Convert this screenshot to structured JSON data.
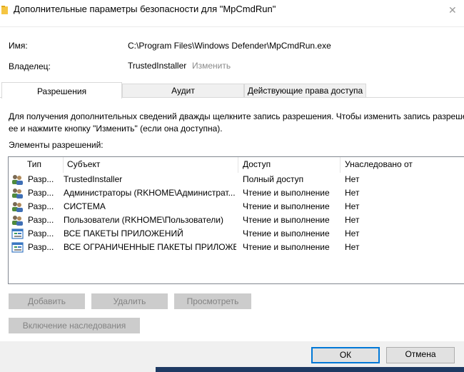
{
  "window": {
    "title": "Дополнительные параметры безопасности  для \"MpCmdRun\"",
    "close_glyph": "✕"
  },
  "fields": {
    "name_label": "Имя:",
    "name_value": "C:\\Program Files\\Windows Defender\\MpCmdRun.exe",
    "owner_label": "Владелец:",
    "owner_value": "TrustedInstaller",
    "owner_change": "Изменить"
  },
  "tabs": [
    {
      "label": "Разрешения",
      "selected": true
    },
    {
      "label": "Аудит",
      "selected": false
    },
    {
      "label": "Действующие права доступа",
      "selected": false
    }
  ],
  "info": {
    "line1": "Для получения дополнительных сведений дважды щелкните запись разрешения. Чтобы изменить запись разреше",
    "line2": "ее и нажмите кнопку \"Изменить\" (если она доступна).",
    "list_label": "Элементы разрешений:"
  },
  "table": {
    "headers": [
      "Тип",
      "Субъект",
      "Доступ",
      "Унаследовано от"
    ],
    "rows": [
      {
        "icon": "users-icon",
        "type": "Разр...",
        "subject": "TrustedInstaller",
        "access": "Полный доступ",
        "inherited": "Нет"
      },
      {
        "icon": "users-icon",
        "type": "Разр...",
        "subject": "Администраторы (RKHOME\\Администрат...",
        "access": "Чтение и выполнение",
        "inherited": "Нет"
      },
      {
        "icon": "users-icon",
        "type": "Разр...",
        "subject": "СИСТЕМА",
        "access": "Чтение и выполнение",
        "inherited": "Нет"
      },
      {
        "icon": "users-icon",
        "type": "Разр...",
        "subject": "Пользователи (RKHOME\\Пользователи)",
        "access": "Чтение и выполнение",
        "inherited": "Нет"
      },
      {
        "icon": "app-package-icon",
        "type": "Разр...",
        "subject": "ВСЕ ПАКЕТЫ ПРИЛОЖЕНИЙ",
        "access": "Чтение и выполнение",
        "inherited": "Нет"
      },
      {
        "icon": "app-package-icon",
        "type": "Разр...",
        "subject": "ВСЕ ОГРАНИЧЕННЫЕ ПАКЕТЫ ПРИЛОЖЕ...",
        "access": "Чтение и выполнение",
        "inherited": "Нет"
      }
    ]
  },
  "buttons": {
    "add": "Добавить",
    "remove": "Удалить",
    "view": "Просмотреть",
    "inherit": "Включение наследования",
    "ok": "ОК",
    "cancel": "Отмена"
  },
  "colors": {
    "accent": "#0078d7",
    "disabled_button": "#cccccc",
    "muted_link": "#8a8a8a"
  }
}
